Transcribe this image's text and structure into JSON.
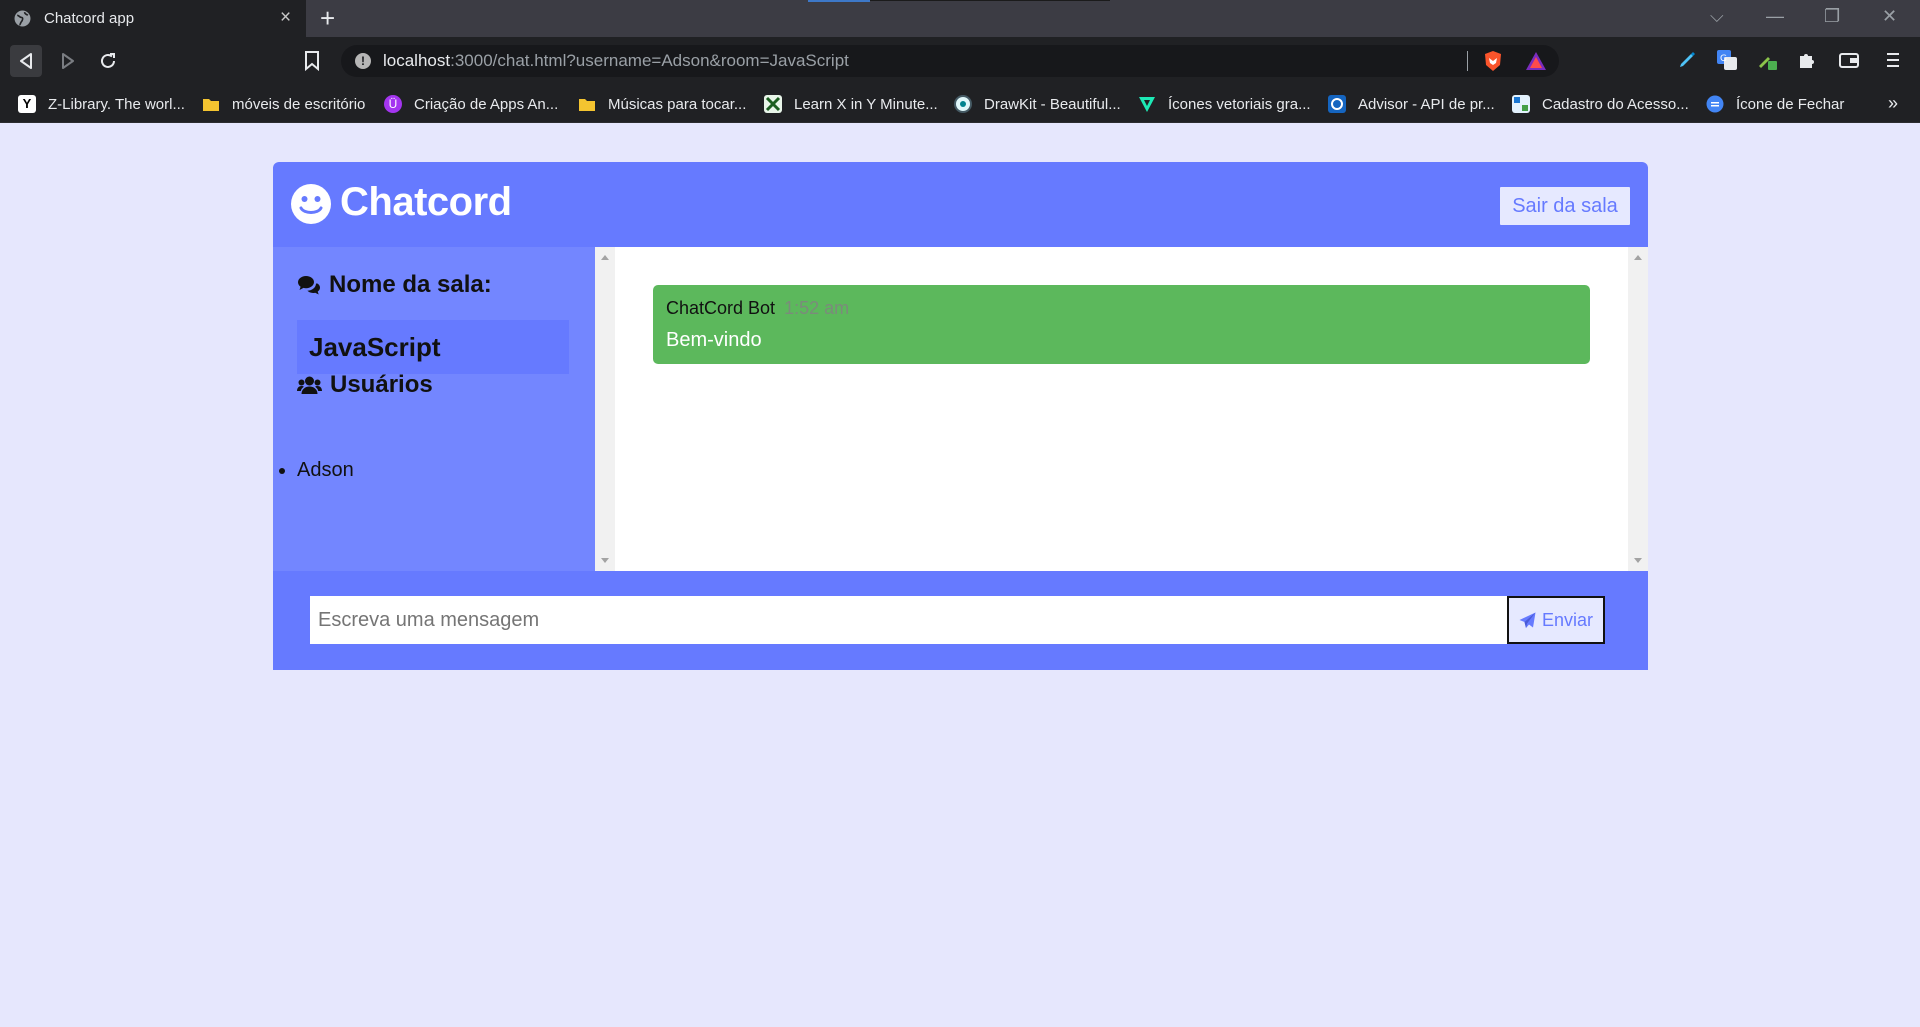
{
  "browser": {
    "tab_title": "Chatcord app",
    "tab_close": "×",
    "new_tab": "+",
    "url_host": "localhost",
    "url_rest": ":3000/chat.html?username=Adson&room=JavaScript",
    "window_controls": [
      "⌵",
      "—",
      "❐",
      "✕"
    ],
    "bookmarks": [
      {
        "label": "Z-Library. The worl...",
        "icon": "z-library-icon",
        "color": "#ffffff"
      },
      {
        "label": "móveis de escritório",
        "icon": "folder-icon",
        "color": "#f4c430"
      },
      {
        "label": "Criação de Apps An...",
        "icon": "udemy-icon",
        "color": "#a435f0"
      },
      {
        "label": "Músicas para tocar...",
        "icon": "folder-icon",
        "color": "#f4c430"
      },
      {
        "label": "Learn X in Y Minute...",
        "icon": "learnx-icon",
        "color": "#e8f5e9"
      },
      {
        "label": "DrawKit - Beautiful...",
        "icon": "drawkit-icon",
        "color": "#e0f7fa"
      },
      {
        "label": "Ícones vetoriais gra...",
        "icon": "freepik-icon",
        "color": "#1de9b6"
      },
      {
        "label": "Advisor - API de pr...",
        "icon": "advisor-icon",
        "color": "#1565c0"
      },
      {
        "label": "Cadastro do Acesso...",
        "icon": "gov-icon",
        "color": "#e3f2fd"
      },
      {
        "label": "Ícone de Fechar",
        "icon": "google-docs-icon",
        "color": "#4285f4"
      }
    ],
    "bookmarks_more": "»"
  },
  "app": {
    "title": "Chatcord",
    "leave_button": "Sair da sala",
    "room_heading": "Nome da sala:",
    "room_name": "JavaScript",
    "users_heading": "Usuários",
    "users": [
      "Adson"
    ],
    "messages": [
      {
        "username": "ChatCord Bot",
        "time": "1:52 am",
        "text": "Bem-vindo"
      }
    ],
    "input_placeholder": "Escreva uma mensagem",
    "send_button": "Enviar",
    "colors": {
      "primary": "#667aff",
      "secondary": "#7386ff",
      "light": "#e6e9ff",
      "bot_message": "#5cb85c",
      "page_background": "#e6e7fd"
    }
  }
}
